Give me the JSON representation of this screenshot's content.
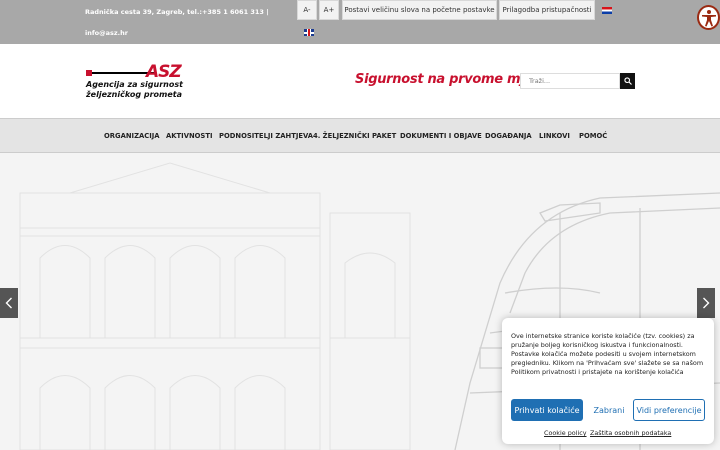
{
  "topbar": {
    "address": "Radnička cesta 39, Zagreb, tel.:+385 1 6061 313  |",
    "email": "info@asz.hr",
    "font_decrease": "A-",
    "font_increase": "A+",
    "font_default": "Postavi veličinu slova na početne postavke",
    "accessibility": "Prilagodba pristupačnosti"
  },
  "header": {
    "logo": {
      "mark": "ASZ",
      "line1": "Agencija za sigurnost",
      "line2": "željezničkog prometa"
    },
    "slogan": "Sigurnost na prvome mjestu!",
    "search_placeholder": "Traži..."
  },
  "nav": {
    "items": [
      {
        "label": "ORGANIZACIJA"
      },
      {
        "label": "AKTIVNOSTI"
      },
      {
        "label": "PODNOSITELJI ZAHTJEVA"
      },
      {
        "label": "4. ŽELJEZNIČKI PAKET"
      },
      {
        "label": "DOKUMENTI I OBJAVE"
      },
      {
        "label": "DOGAĐANJA"
      },
      {
        "label": "LINKOVI"
      },
      {
        "label": "POMOĆ"
      }
    ]
  },
  "cookie": {
    "text": "Ove internetske stranice koriste kolačiće (tzv. cookies) za pružanje boljeg korisničkog iskustva i funkcionalnosti. Postavke kolačića možete podesiti u svojem internetskom pregledniku. Klikom na 'Prihvaćam sve' slažete se sa našom Politikom privatnosti i pristajete na korištenje kolačića",
    "accept": "Prihvati kolačiće",
    "deny": "Zabrani",
    "preferences": "Vidi preferencije",
    "cookie_policy": "Cookie policy",
    "privacy": "Zaštita osobnih podataka"
  },
  "colors": {
    "brand_red": "#c8102e",
    "topbar_grey": "#a8a8a8",
    "cookie_blue": "#1f6fb3"
  }
}
